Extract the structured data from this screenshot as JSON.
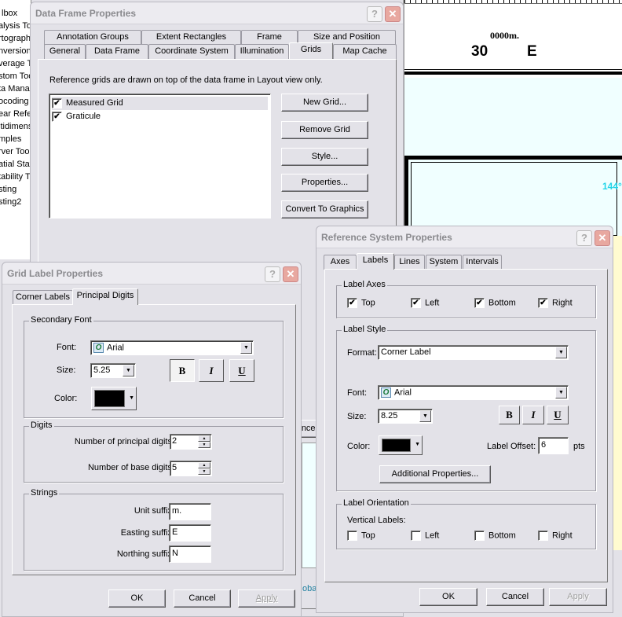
{
  "background": {
    "toolbox_items": [
      "lbox",
      "alysis To",
      "rtograph",
      "nversion",
      "verage T",
      "stom Too",
      "ta Mana",
      "ocoding",
      "ear Refe",
      "ltidimens",
      "mples",
      "rver Too",
      "atial Stat",
      "tability T",
      "sting",
      "sting2"
    ],
    "map": {
      "unit_label": "0000m.",
      "principal_label": "30",
      "suffix_label": "E",
      "graticule_label": "144°"
    },
    "partial_button": "ncel",
    "partial_text": "oba"
  },
  "data_frame_dialog": {
    "title": "Data Frame Properties",
    "tabs_row1": [
      "Annotation Groups",
      "Extent Rectangles",
      "Frame",
      "Size and Position"
    ],
    "tabs_row2": [
      "General",
      "Data Frame",
      "Coordinate System",
      "Illumination",
      "Grids",
      "Map Cache"
    ],
    "selected_tab": "Grids",
    "description": "Reference grids are drawn on top of the data frame in Layout view only.",
    "grids": [
      {
        "label": "Measured Grid",
        "checked": true,
        "selected": true
      },
      {
        "label": "Graticule",
        "checked": true,
        "selected": false
      }
    ],
    "buttons": {
      "new_grid": "New Grid...",
      "remove_grid": "Remove Grid",
      "style": "Style...",
      "properties": "Properties...",
      "convert": "Convert To Graphics"
    }
  },
  "grid_label_dialog": {
    "title": "Grid Label Properties",
    "tabs": [
      "Corner Labels",
      "Principal Digits"
    ],
    "selected_tab": "Principal Digits",
    "secondary_font": {
      "legend": "Secondary Font",
      "font_label": "Font:",
      "font_value": "Arial",
      "size_label": "Size:",
      "size_value": "5.25",
      "bold": "B",
      "italic": "I",
      "underline": "U",
      "bold_on": true,
      "color_label": "Color:",
      "color": "#000000"
    },
    "digits": {
      "legend": "Digits",
      "principal_label": "Number of principal digits:",
      "principal_value": "2",
      "base_label": "Number of base digits:",
      "base_value": "5"
    },
    "strings": {
      "legend": "Strings",
      "unit_label": "Unit suffix:",
      "unit_value": "m.",
      "easting_label": "Easting suffix:",
      "easting_value": "E",
      "northing_label": "Northing suffix:",
      "northing_value": "N"
    },
    "buttons": {
      "ok": "OK",
      "cancel": "Cancel",
      "apply": "Apply"
    }
  },
  "ref_system_dialog": {
    "title": "Reference System Properties",
    "tabs": [
      "Axes",
      "Labels",
      "Lines",
      "System",
      "Intervals"
    ],
    "selected_tab": "Labels",
    "label_axes": {
      "legend": "Label Axes",
      "items": [
        {
          "label": "Top",
          "checked": true
        },
        {
          "label": "Left",
          "checked": true
        },
        {
          "label": "Bottom",
          "checked": true
        },
        {
          "label": "Right",
          "checked": true
        }
      ]
    },
    "label_style": {
      "legend": "Label Style",
      "format_label": "Format:",
      "format_value": "Corner Label",
      "font_label": "Font:",
      "font_value": "Arial",
      "size_label": "Size:",
      "size_value": "8.25",
      "bold": "B",
      "italic": "I",
      "underline": "U",
      "color_label": "Color:",
      "color": "#000000",
      "offset_label": "Label Offset:",
      "offset_value": "6",
      "offset_unit": "pts",
      "additional": "Additional Properties..."
    },
    "label_orientation": {
      "legend": "Label Orientation",
      "vertical_label": "Vertical Labels:",
      "items": [
        {
          "label": "Top",
          "checked": false
        },
        {
          "label": "Left",
          "checked": false
        },
        {
          "label": "Bottom",
          "checked": false
        },
        {
          "label": "Right",
          "checked": false
        }
      ]
    },
    "buttons": {
      "ok": "OK",
      "cancel": "Cancel",
      "apply": "Apply"
    }
  }
}
